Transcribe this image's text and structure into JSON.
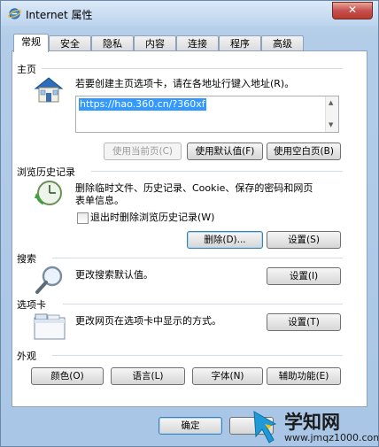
{
  "window": {
    "title": "Internet 属性",
    "close_label": "✕"
  },
  "tabs": [
    "常规",
    "安全",
    "隐私",
    "内容",
    "连接",
    "程序",
    "高级"
  ],
  "home": {
    "heading": "主页",
    "prompt": "若要创建主页选项卡，请在各地址行键入地址(R)。",
    "url": "https://hao.360.cn/?360xf",
    "btn_current": "使用当前页(C)",
    "btn_default": "使用默认值(F)",
    "btn_blank": "使用空白页(B)"
  },
  "history": {
    "heading": "浏览历史记录",
    "desc_line1": "删除临时文件、历史记录、Cookie、保存的密码和网页",
    "desc_line2": "表单信息。",
    "checkbox_label": "退出时删除浏览历史记录(W)",
    "btn_delete": "删除(D)...",
    "btn_settings": "设置(S)"
  },
  "search": {
    "heading": "搜索",
    "desc": "更改搜索默认值。",
    "btn_settings": "设置(I)"
  },
  "tabs_section": {
    "heading": "选项卡",
    "desc": "更改网页在选项卡中显示的方式。",
    "btn_settings": "设置(T)"
  },
  "appearance": {
    "heading": "外观",
    "btn_colors": "颜色(O)",
    "btn_languages": "语言(L)",
    "btn_fonts": "字体(N)",
    "btn_accessibility": "辅助功能(E)"
  },
  "footer": {
    "btn_ok": "确定"
  },
  "watermark": {
    "name": "学知网",
    "url": "www.jmqz1000.com"
  }
}
